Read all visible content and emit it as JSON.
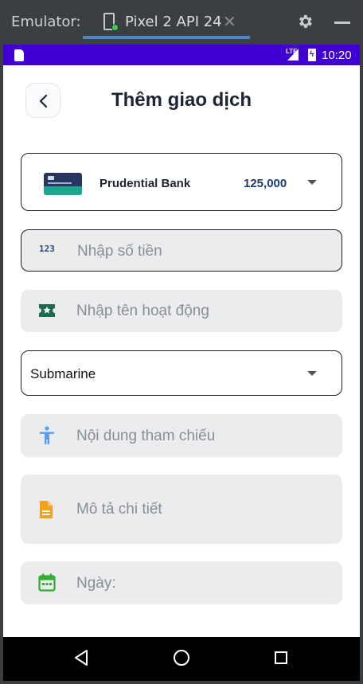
{
  "emulator": {
    "label": "Emulator:",
    "tab_title": "Pixel 2 API 24"
  },
  "status_bar": {
    "network": "LTE",
    "time": "10:20"
  },
  "header": {
    "title": "Thêm giao dịch"
  },
  "account": {
    "bank_name": "Prudential Bank",
    "balance": "125,000"
  },
  "form": {
    "amount_icon_text": "123",
    "amount_placeholder": "Nhập số tiền",
    "activity_placeholder": "Nhập tên hoạt động",
    "category_value": "Submarine",
    "reference_placeholder": "Nội dung tham chiếu",
    "description_placeholder": "Mô tả chi tiết",
    "date_placeholder": "Ngày:"
  },
  "colors": {
    "status_bar": "#3f00d1",
    "title": "#1f2433",
    "balance": "#1e3a73",
    "ticket_icon": "#1e6b4e",
    "accessibility_icon": "#5b9bf0",
    "document_icon": "#f4a21c",
    "calendar_icon": "#2fae2f"
  }
}
